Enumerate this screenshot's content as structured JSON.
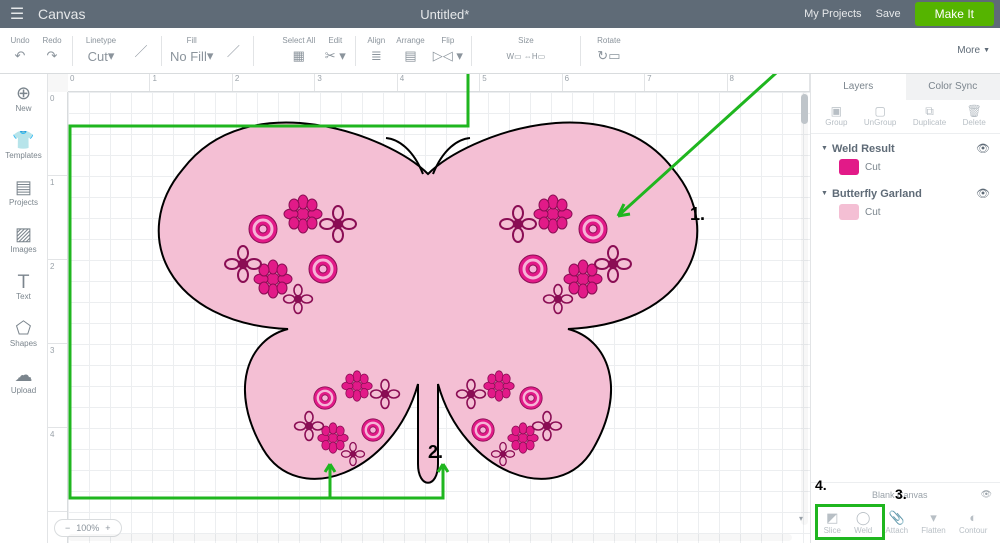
{
  "app": {
    "name": "Canvas",
    "document": "Untitled*"
  },
  "topbar": {
    "myprojects": "My Projects",
    "save": "Save",
    "makeit": "Make It"
  },
  "toolbar": {
    "undo": "Undo",
    "redo": "Redo",
    "linetype": "Linetype",
    "cut": "Cut",
    "fill": "Fill",
    "nofill": "No Fill",
    "selectall": "Select All",
    "edit": "Edit",
    "align": "Align",
    "arrange": "Arrange",
    "flip": "Flip",
    "size": "Size",
    "w": "W",
    "h": "H",
    "lock": "⇔",
    "rotate": "Rotate",
    "more": "More"
  },
  "left": {
    "new": "New",
    "templates": "Templates",
    "projects": "Projects",
    "images": "Images",
    "text": "Text",
    "shapes": "Shapes",
    "upload": "Upload"
  },
  "ruler_h": [
    "0",
    "1",
    "2",
    "3",
    "4",
    "5",
    "6",
    "7",
    "8"
  ],
  "ruler_v": [
    "0",
    "1",
    "2",
    "3",
    "4"
  ],
  "zoom": {
    "minus": "−",
    "value": "100%",
    "plus": "+"
  },
  "rpanel": {
    "tab_layers": "Layers",
    "tab_colorsync": "Color Sync",
    "group": "Group",
    "ungroup": "UnGroup",
    "duplicate": "Duplicate",
    "delete": "Delete",
    "layers": [
      {
        "name": "Weld Result",
        "sub": "Cut",
        "thumb_color": "#e21a88"
      },
      {
        "name": "Butterfly Garland",
        "sub": "Cut",
        "thumb_color": "#f4bfd4"
      }
    ],
    "blank": "Blank Canvas",
    "slice": "Slice",
    "weld": "Weld",
    "attach": "Attach",
    "flatten": "Flatten",
    "contour": "Contour"
  },
  "annotations": {
    "n1": "1.",
    "n2": "2.",
    "n3": "3.",
    "n4": "4."
  }
}
